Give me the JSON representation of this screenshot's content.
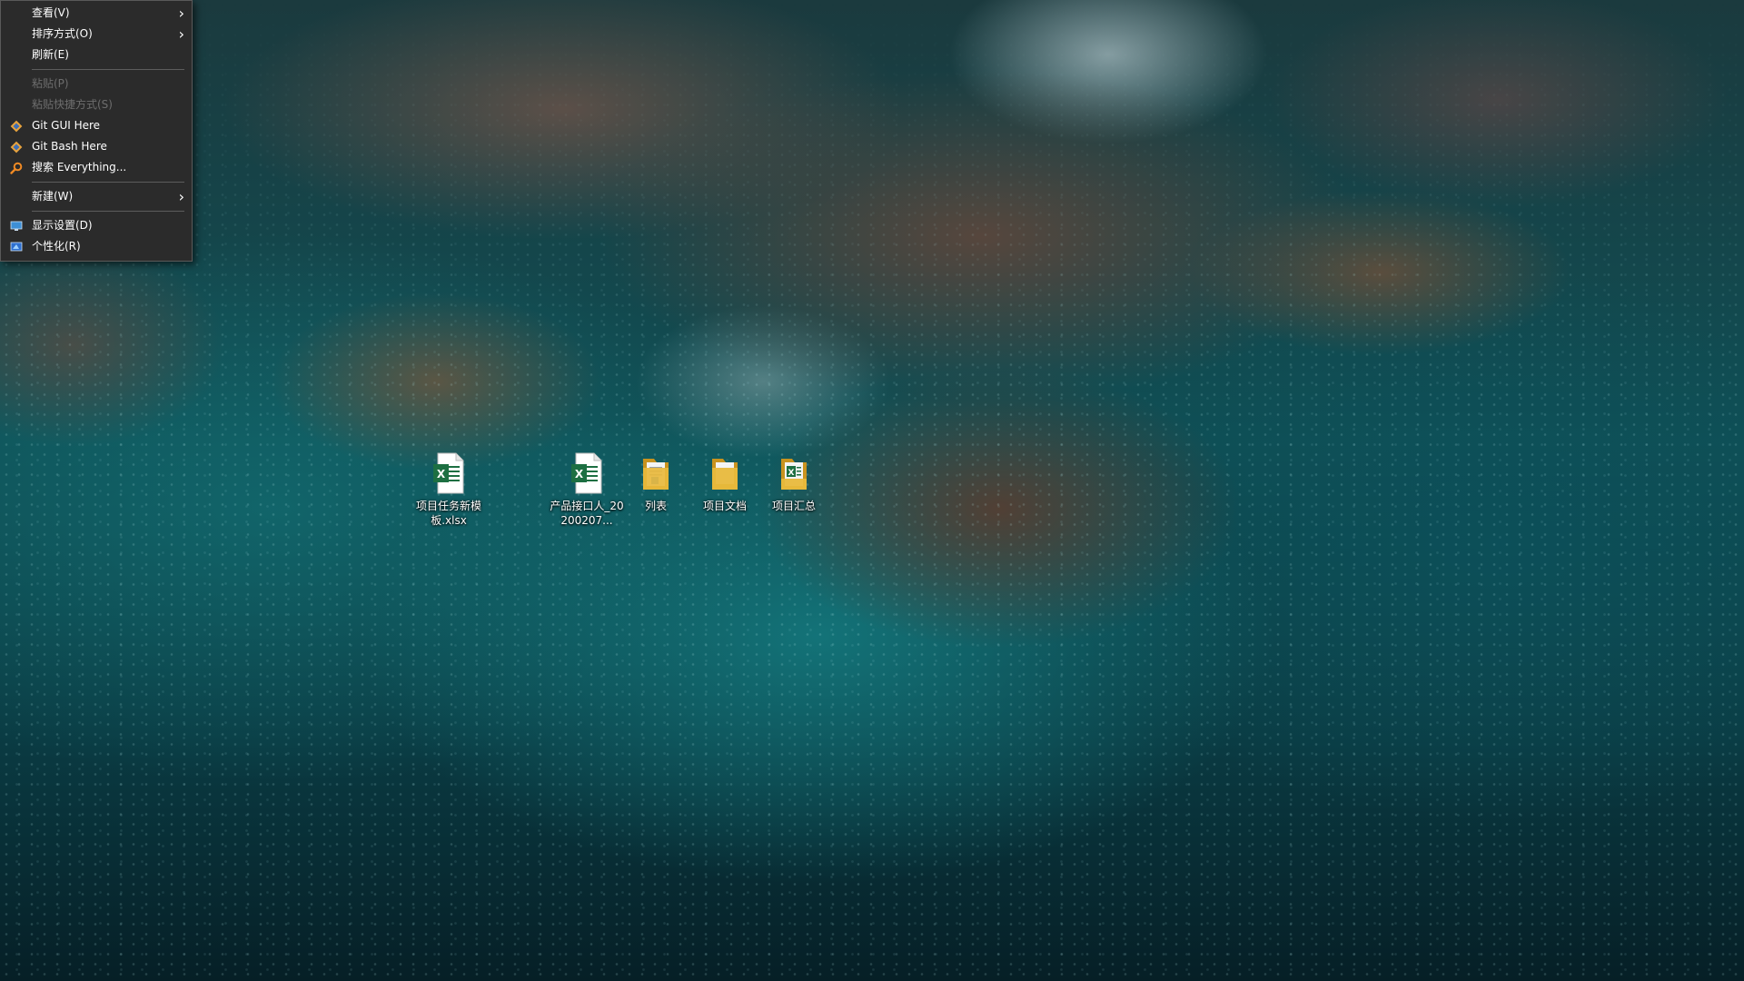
{
  "context_menu": {
    "items": [
      {
        "label": "查看(V)",
        "has_submenu": true,
        "enabled": true,
        "icon": null
      },
      {
        "label": "排序方式(O)",
        "has_submenu": true,
        "enabled": true,
        "icon": null
      },
      {
        "label": "刷新(E)",
        "has_submenu": false,
        "enabled": true,
        "icon": null
      },
      {
        "label": "粘贴(P)",
        "has_submenu": false,
        "enabled": false,
        "icon": null
      },
      {
        "label": "粘贴快捷方式(S)",
        "has_submenu": false,
        "enabled": false,
        "icon": null
      },
      {
        "label": "Git GUI Here",
        "has_submenu": false,
        "enabled": true,
        "icon": "git-icon"
      },
      {
        "label": "Git Bash Here",
        "has_submenu": false,
        "enabled": true,
        "icon": "git-icon"
      },
      {
        "label": "搜索 Everything...",
        "has_submenu": false,
        "enabled": true,
        "icon": "magnifier-icon"
      },
      {
        "label": "新建(W)",
        "has_submenu": true,
        "enabled": true,
        "icon": null
      },
      {
        "label": "显示设置(D)",
        "has_submenu": false,
        "enabled": true,
        "icon": "display-icon"
      },
      {
        "label": "个性化(R)",
        "has_submenu": false,
        "enabled": true,
        "icon": "personalize-icon"
      }
    ],
    "submenu_glyph": "›"
  },
  "desktop": {
    "icons": [
      {
        "label": "项目任务新模板.xlsx",
        "type": "excel-file-icon"
      },
      {
        "label": "产品接口人_20200207...",
        "type": "excel-file-icon"
      },
      {
        "label": "列表",
        "type": "folder-icon"
      },
      {
        "label": "项目文档",
        "type": "folder-icon"
      },
      {
        "label": "项目汇总",
        "type": "folder-excel-icon"
      }
    ]
  },
  "colors": {
    "menu_background": "#2b2b2b",
    "menu_text": "#ffffff",
    "menu_disabled_text": "#6d6d6d",
    "excel_green": "#1d6f42",
    "folder_yellow": "#e8b93c"
  }
}
